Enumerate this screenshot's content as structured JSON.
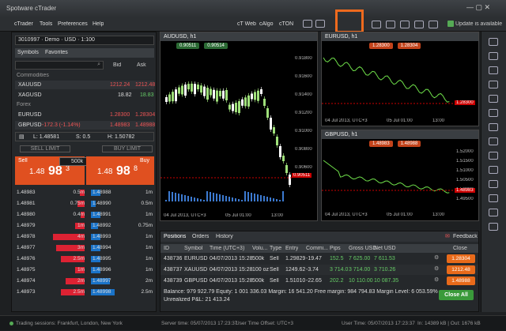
{
  "app": {
    "title": "Spotware cTrader"
  },
  "menu": [
    "cTrader",
    "Tools",
    "Preferences",
    "Help"
  ],
  "toolbar": {
    "links": [
      "cT Web",
      "cAlgo",
      "cTON"
    ],
    "update": "Update is available"
  },
  "account": {
    "label": "3010997 · Demo · USD · 1:100"
  },
  "symbols": {
    "tabs": [
      "Symbols",
      "Favorites"
    ],
    "bid": "Bid",
    "ask": "Ask",
    "groups": [
      {
        "name": "Commodities",
        "items": [
          {
            "sym": "XAUUSD",
            "bid": "1212.24",
            "ask": "1212.48"
          },
          {
            "sym": "XAGUSD",
            "bid": "18.82",
            "ask": "18.83"
          }
        ]
      },
      {
        "name": "Forex",
        "items": [
          {
            "sym": "EURUSD",
            "bid": "1.28300",
            "ask": "1.28304"
          },
          {
            "sym": "GBPUSD",
            "change": "-172.3 (-1.14%)",
            "bid": "1.48983",
            "ask": "1.48988"
          }
        ]
      }
    ],
    "stats": {
      "low": "L: 1.48581",
      "spread": "S: 0.5",
      "high": "H: 1.50782"
    },
    "sell_limit": "SELL LIMIT",
    "buy_limit": "BUY LIMIT"
  },
  "trade": {
    "sell": "Sell",
    "buy": "Buy",
    "volume": "500k",
    "sell_price": [
      "1.48",
      "98",
      "3"
    ],
    "buy_price": [
      "1.48",
      "98",
      "8"
    ]
  },
  "dom": [
    {
      "bid": "1.48983",
      "bvol": "0.5m",
      "ask": "1.48988",
      "avol": "1m"
    },
    {
      "bid": "1.48981",
      "bvol": "0.75m",
      "ask": "1.48990",
      "avol": "0.5m"
    },
    {
      "bid": "1.48980",
      "bvol": "0.4m",
      "ask": "1.48991",
      "avol": "1m"
    },
    {
      "bid": "1.48979",
      "bvol": "1m",
      "ask": "1.48992",
      "avol": "0.75m"
    },
    {
      "bid": "1.48978",
      "bvol": "4m",
      "ask": "1.48993",
      "avol": "1m"
    },
    {
      "bid": "1.48977",
      "bvol": "3m",
      "ask": "1.48994",
      "avol": "1m"
    },
    {
      "bid": "1.48976",
      "bvol": "2.5m",
      "ask": "1.48995",
      "avol": "1m"
    },
    {
      "bid": "1.48975",
      "bvol": "1m",
      "ask": "1.48996",
      "avol": "1m"
    },
    {
      "bid": "1.48974",
      "bvol": "2m",
      "ask": "1.48997",
      "avol": "2m"
    },
    {
      "bid": "1.48973",
      "bvol": "2.5m",
      "ask": "1.48998",
      "avol": "2.5m"
    }
  ],
  "charts": {
    "aud": {
      "title": "AUDUSD, h1",
      "bid": "0.90511",
      "ask": "0.90514",
      "cur": "0.90511",
      "ticks": [
        "0.91800",
        "0.91600",
        "0.91400",
        "0.91200",
        "0.91000",
        "0.90800",
        "0.90600"
      ],
      "x": [
        "04 Jul 2013, UTC+3",
        "05 Jul 01:00",
        "13:00"
      ]
    },
    "eur": {
      "title": "EURUSD, h1",
      "bid": "1.28300",
      "ask": "1.28304",
      "cur": "1.28300",
      "x": [
        "04 Jul 2013, UTC+3",
        "05 Jul 01:00",
        "13:00"
      ]
    },
    "gbp": {
      "title": "GBPUSD, h1",
      "bid": "1.48983",
      "ask": "1.48988",
      "cur": "1.48983",
      "ticks": [
        "1.52000",
        "1.51500",
        "1.51000",
        "1.50500",
        "1.50000",
        "1.49500"
      ],
      "x": [
        "04 Jul 2013, UTC+3",
        "05 Jul 01:00",
        "13:00"
      ]
    }
  },
  "positions": {
    "tabs": [
      "Positions",
      "Orders",
      "History"
    ],
    "feedback": "Feedback",
    "headers": [
      "ID",
      "Symbol",
      "Time (UTC+3)",
      "Volu...",
      "Type",
      "Entry",
      "Commi...",
      "Pips",
      "Gross USD",
      "Net USD",
      "Close"
    ],
    "rows": [
      {
        "id": "438736",
        "sym": "EURUSD",
        "time": "04/07/2013 15:28",
        "vol": "500k",
        "type": "Sell",
        "entry": "1.29829",
        "comm": "-19.47",
        "pips": "152.5",
        "gross": "7 625.00",
        "net": "7 611.53",
        "close": "1.28304"
      },
      {
        "id": "438737",
        "sym": "XAUUSD",
        "time": "04/07/2013 15:28",
        "vol": "100 oz",
        "type": "Sell",
        "entry": "1249.62",
        "comm": "-3.74",
        "pips": "3 714.0",
        "gross": "3 714.00",
        "net": "3 710.26",
        "close": "1212.48"
      },
      {
        "id": "438739",
        "sym": "GBPUSD",
        "time": "04/07/2013 15:28",
        "vol": "500k",
        "type": "Sell",
        "entry": "1.51010",
        "comm": "-22.65",
        "pips": "202.2",
        "gross": "10 110.00",
        "net": "10 087.35",
        "close": "1.48988"
      }
    ],
    "summary1": "Balance: 979 922.79   Equity: 1 001 336.03   Margin: 16 541.20   Free margin: 984 794.83   Margin Level: 6 053.59%",
    "summary2": "Unrealized P&L: 21 413.24",
    "closeall": "Close All"
  },
  "status": {
    "sessions": "Trading sessions: Frankfurt, London, New York",
    "server": "Server time: 05/07/2013 17:23:37",
    "offset": "User Time Offset: UTC+3",
    "user": "User Time: 05/07/2013 17:23:37",
    "traffic": "In: 14389 kB | Out: 1676 kB"
  }
}
